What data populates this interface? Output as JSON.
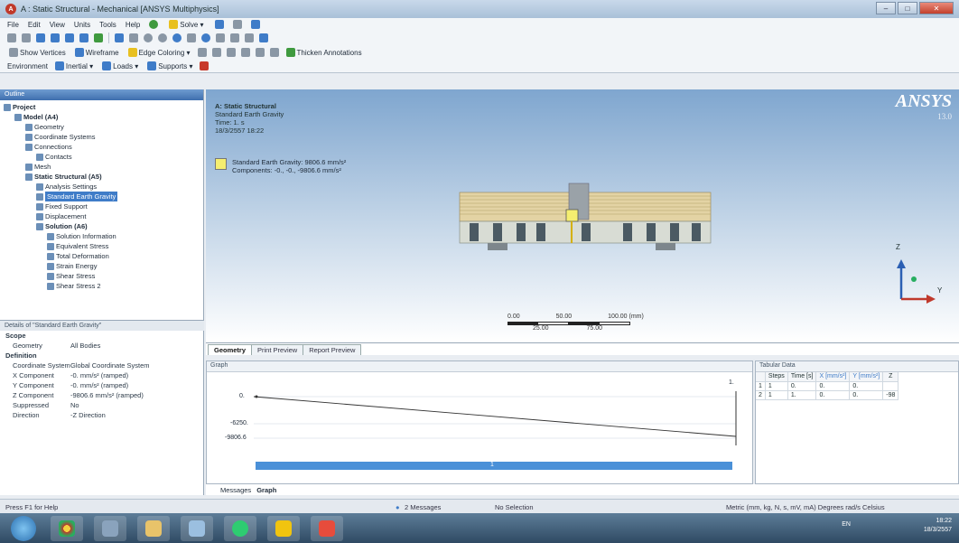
{
  "window": {
    "title": "A : Static Structural - Mechanical [ANSYS Multiphysics]",
    "icon_label": "A",
    "buttons": {
      "minimize": "–",
      "maximize": "□",
      "close": "✕"
    }
  },
  "menubar": [
    "File",
    "Edit",
    "View",
    "Units",
    "Tools",
    "Help"
  ],
  "toolbar1": {
    "solve": "Solve ▾"
  },
  "toolbar2": {
    "show_vertices": "Show Vertices",
    "wireframe": "Wireframe",
    "edge_coloring": "Edge Coloring ▾",
    "thicken_annotations": "Thicken Annotations"
  },
  "toolbar3": {
    "environment": "Environment",
    "inertial": "Inertial ▾",
    "loads": "Loads ▾",
    "supports": "Supports ▾"
  },
  "outline": {
    "header": "Outline",
    "items": [
      {
        "label": "Project",
        "indent": 0,
        "bold": true
      },
      {
        "label": "Model (A4)",
        "indent": 1,
        "bold": true
      },
      {
        "label": "Geometry",
        "indent": 2
      },
      {
        "label": "Coordinate Systems",
        "indent": 2
      },
      {
        "label": "Connections",
        "indent": 2
      },
      {
        "label": "Contacts",
        "indent": 3
      },
      {
        "label": "Mesh",
        "indent": 2
      },
      {
        "label": "Static Structural (A5)",
        "indent": 2,
        "bold": true
      },
      {
        "label": "Analysis Settings",
        "indent": 3
      },
      {
        "label": "Standard Earth Gravity",
        "indent": 3,
        "selected": true
      },
      {
        "label": "Fixed Support",
        "indent": 3
      },
      {
        "label": "Displacement",
        "indent": 3
      },
      {
        "label": "Solution (A6)",
        "indent": 3,
        "bold": true
      },
      {
        "label": "Solution Information",
        "indent": 4
      },
      {
        "label": "Equivalent Stress",
        "indent": 4
      },
      {
        "label": "Total Deformation",
        "indent": 4
      },
      {
        "label": "Strain Energy",
        "indent": 4
      },
      {
        "label": "Shear Stress",
        "indent": 4
      },
      {
        "label": "Shear Stress 2",
        "indent": 4
      }
    ]
  },
  "details": {
    "header": "Details of \"Standard Earth Gravity\"",
    "rows": [
      {
        "section": true,
        "key": "Scope"
      },
      {
        "key": "Geometry",
        "value": "All Bodies"
      },
      {
        "section": true,
        "key": "Definition"
      },
      {
        "key": "Coordinate System",
        "value": "Global Coordinate System"
      },
      {
        "key": "X Component",
        "value": "-0. mm/s² (ramped)"
      },
      {
        "key": "Y Component",
        "value": "-0. mm/s² (ramped)"
      },
      {
        "key": "Z Component",
        "value": "-9806.6 mm/s² (ramped)"
      },
      {
        "key": "Suppressed",
        "value": "No"
      },
      {
        "key": "Direction",
        "value": "-Z Direction"
      }
    ]
  },
  "viewport": {
    "title": "A: Static Structural",
    "subtitle": "Standard Earth Gravity",
    "time": "Time: 1. s",
    "date": "18/3/2557 18:22",
    "legend_line1": "Standard Earth Gravity: 9806.6 mm/s²",
    "legend_line2": "Components: -0., -0., -9806.6 mm/s²",
    "logo": "ANSYS",
    "version": "13.0",
    "scale_labels": [
      "0.00",
      "50.00",
      "100.00 (mm)"
    ],
    "scale_sub": [
      "25.00",
      "75.00"
    ],
    "axis_z": "Z",
    "axis_y": "Y"
  },
  "view_tabs": [
    "Geometry",
    "Print Preview",
    "Report Preview"
  ],
  "graph": {
    "header": "Graph",
    "y_labels": [
      "0.",
      "-6250.",
      "-9806.6"
    ],
    "x_end_label": "1.",
    "marker_label": "1"
  },
  "tabular": {
    "header": "Tabular Data",
    "columns": [
      "Steps",
      "Time [s]",
      "X [mm/s²]",
      "Y [mm/s²]",
      "Z"
    ],
    "rows": [
      [
        "1",
        "1",
        "0.",
        "0.",
        "0."
      ],
      [
        "2",
        "1",
        "1.",
        "0.",
        "0.",
        "-98"
      ]
    ]
  },
  "bottom_tabs": [
    "Messages",
    "Graph"
  ],
  "status": {
    "help": "Press F1 for Help",
    "messages": "2 Messages",
    "selection": "No Selection",
    "units": "Metric (mm, kg, N, s, mV, mA)  Degrees  rad/s  Celsius"
  },
  "taskbar": {
    "lang": "EN",
    "time": "18:22",
    "date": "18/3/2557"
  },
  "colors": {
    "accent": "#3f7cc8",
    "gravity_box": "#f5ee70",
    "bar": "#4a90d8"
  }
}
